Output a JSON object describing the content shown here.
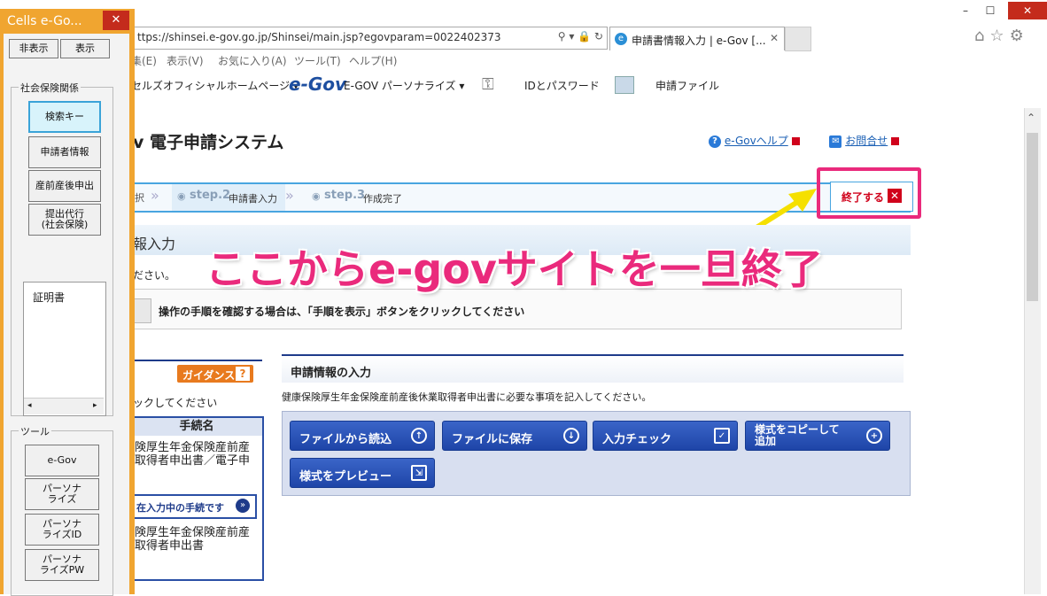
{
  "browser": {
    "address": "https://shinsei.e-gov.go.jp/Shinsei/main.jsp?egovparam=0022402373",
    "address_visible": "ttps://shinsei.e-gov.go.jp/Shinsei/main.jsp?egovparam=0022402373",
    "tab_title": "申請書情報入力 | e-Gov [...",
    "menu": [
      "集(E)",
      "表示(V)",
      "お気に入り(A)",
      "ツール(T)",
      "ヘルプ(H)"
    ],
    "favorites": {
      "homepage": "セルズオフィシャルホームページ ▾",
      "egov_logo": "e-Gov",
      "egov_personalize": "E-GOV パーソナライズ ▾",
      "id_password": "IDとパスワード",
      "application_file": "申請ファイル"
    }
  },
  "page": {
    "title": "v 電子申請システム",
    "help_link": "e-Govヘルプ",
    "contact_link": "お問合せ",
    "steps": {
      "step1_tail": "択",
      "step2_num": "step.2",
      "step2_label": "申請書入力",
      "step3_num": "step.3",
      "step3_label": "作成完了"
    },
    "end_button": "終了する",
    "section_title": "報入力",
    "instruction_tail": "ださい。",
    "instruction_msg": "操作の手順を確認する場合は、「手順を表示」ボタンをクリックしてください",
    "annotation": "ここからe-govサイトを一旦終了"
  },
  "left_panel": {
    "guidance_button": "ガイダンス",
    "guidance_note": "ックしてください",
    "table_header": "手続名",
    "procedure_1": "険厚生年金保険産前産\n取得者申出書／電子申",
    "current_label": "在入力中の手続です",
    "procedure_2": "険厚生年金保険産前産\n取得者申出書"
  },
  "form": {
    "header": "申請情報の入力",
    "description": "健康保険厚生年金保険産前産後休業取得者申出書に必要な事項を記入してください。",
    "buttons": {
      "read_file": "ファイルから読込",
      "save_file": "ファイルに保存",
      "input_check": "入力チェック",
      "copy_form_l1": "様式をコピーして",
      "copy_form_l2": "追加",
      "preview": "様式をプレビュー"
    }
  },
  "cells_window": {
    "title": "Cells e-Go...",
    "hide": "非表示",
    "show": "表示",
    "group_social": "社会保険関係",
    "search_key": "検索キー",
    "applicant_info": "申請者情報",
    "maternity": "産前産後申出",
    "agent_l1": "提出代行",
    "agent_l2": "(社会保険)",
    "certificate": "証明書",
    "group_tools": "ツール",
    "egov": "e-Gov",
    "personalize_l1": "パーソナ",
    "personalize_l2": "ライズ",
    "personalize_id_l1": "パーソナ",
    "personalize_id_l2": "ライズID",
    "personalize_pw_l1": "パーソナ",
    "personalize_pw_l2": "ライズPW"
  },
  "colors": {
    "accent_blue": "#1e45a8",
    "highlight_pink": "#ea2a7c",
    "cells_orange": "#f0a530"
  }
}
